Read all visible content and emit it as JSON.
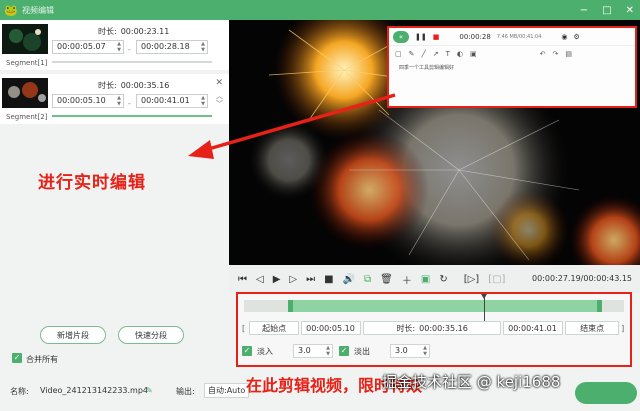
{
  "app": {
    "title": "视频编辑",
    "logo_icon": "frog-logo-icon"
  },
  "window_controls": [
    "−",
    "□",
    "✕"
  ],
  "segments": [
    {
      "label": "Segment[1]",
      "duration_label": "时长:",
      "duration": "00:00:23.11",
      "start": "00:00:05.07",
      "end": "00:00:28.18",
      "selected": false
    },
    {
      "label": "Segment[2]",
      "duration_label": "时长:",
      "duration": "00:00:35.16",
      "start": "00:00:05.10",
      "end": "00:00:41.01",
      "selected": true
    }
  ],
  "annotations": {
    "live_edit": "进行实时编辑",
    "clip_here": "在此剪辑视频，限时特效",
    "watermark": "掘金技术社区 @ keji1688"
  },
  "left_buttons": {
    "new_segment": "新增片段",
    "quick_split": "快速分段"
  },
  "merge_all": {
    "label": "合并所有",
    "checked": true
  },
  "overlay_panel": {
    "time": "00:00:28",
    "info": "7.46 MB/00:41:04",
    "body_text": "四季一个工具剪辑编辑好"
  },
  "player": {
    "time_readout": "00:00:27.19/00:00:43.15"
  },
  "edit": {
    "start_button": "起始点",
    "start_time": "00:00:05.10",
    "duration_label": "时长:",
    "duration": "00:00:35.16",
    "end_time": "00:00:41.01",
    "end_button": "结束点",
    "fade_in_label": "淡入",
    "fade_in_value": "3.0",
    "fade_out_label": "淡出",
    "fade_out_value": "3.0",
    "fade_in_checked": true,
    "fade_out_checked": true
  },
  "bottom": {
    "name_label": "名称:",
    "name_value": "Video_241213142233.mp4",
    "output_label": "输出:",
    "output_value": "自动:Auto"
  },
  "colors": {
    "accent": "#4caf6e",
    "annotation": "#e62117"
  }
}
